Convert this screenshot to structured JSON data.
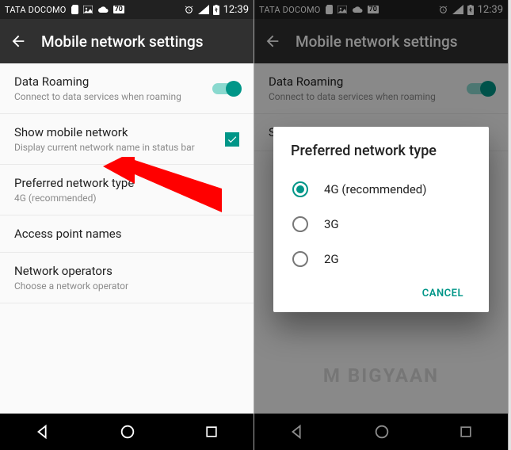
{
  "status": {
    "carrier": "TATA DOCOMO",
    "battery_pct": "70",
    "time": "12:39"
  },
  "toolbar": {
    "title": "Mobile network settings"
  },
  "settings": {
    "data_roaming": {
      "title": "Data Roaming",
      "sub": "Connect to data services when roaming"
    },
    "show_network": {
      "title": "Show mobile network",
      "sub": "Display current network name in status bar"
    },
    "pref_type": {
      "title": "Preferred network type",
      "sub": "4G (recommended)"
    },
    "apn": {
      "title": "Access point names"
    },
    "operators": {
      "title": "Network operators",
      "sub": "Choose a network operator"
    }
  },
  "dialog": {
    "title": "Preferred network type",
    "opt_4g": "4G (recommended)",
    "opt_3g": "3G",
    "opt_2g": "2G",
    "cancel": "CANCEL"
  },
  "watermark": "M BIGYAAN",
  "colors": {
    "accent": "#009688",
    "annotation": "#ff0000"
  }
}
